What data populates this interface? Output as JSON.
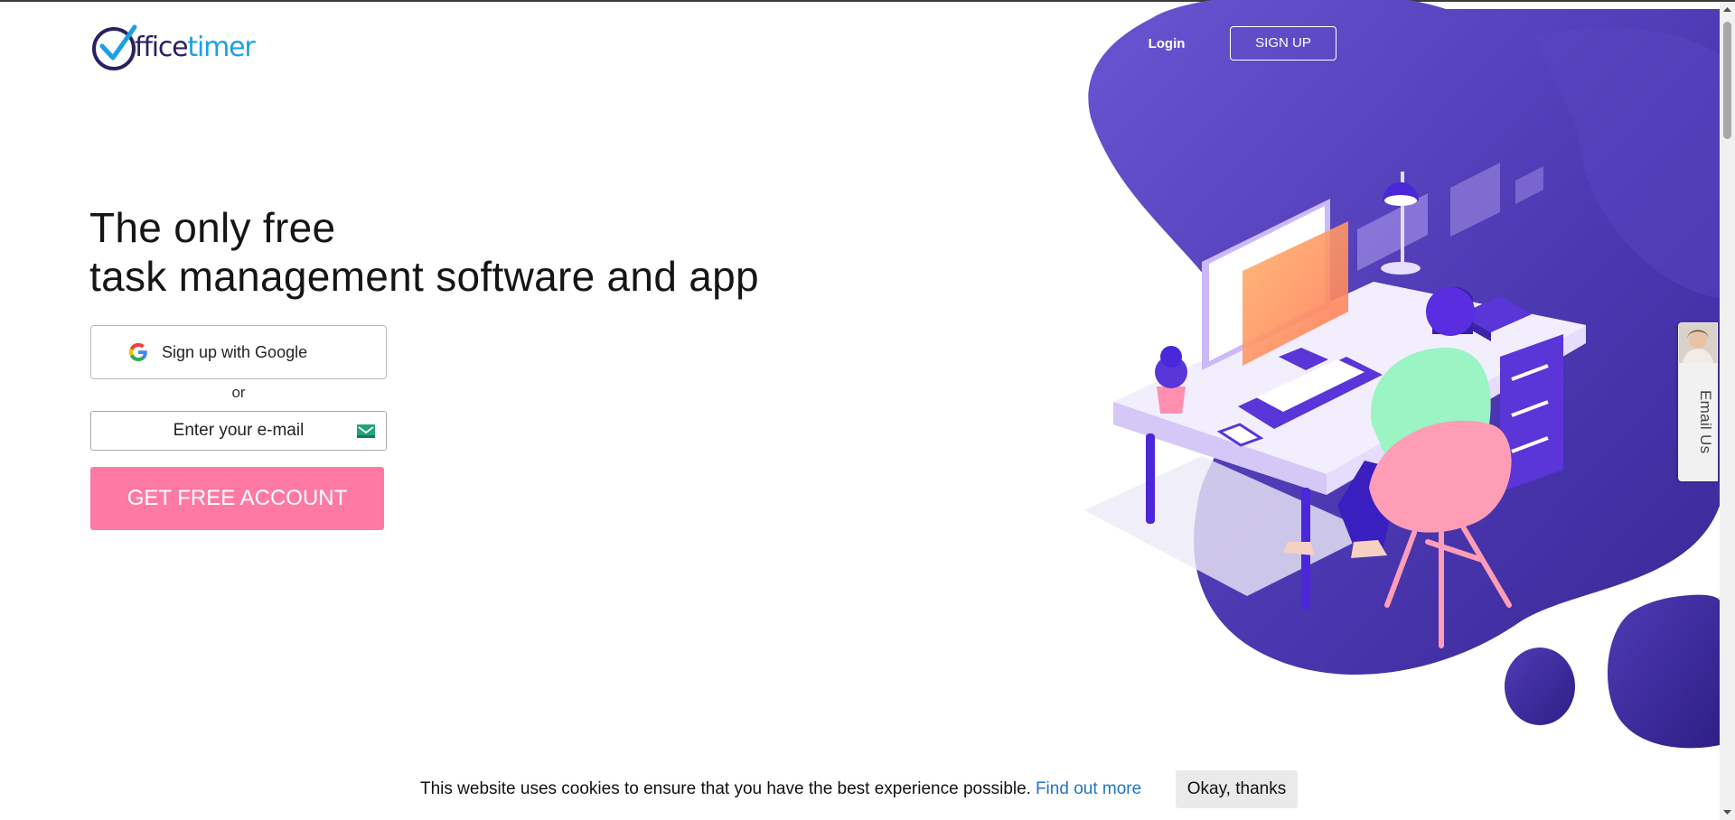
{
  "brand": {
    "logo_part_dark": "ffice",
    "logo_part_light": "timer",
    "colors": {
      "navy": "#2a2160",
      "blue": "#1ba1e2",
      "purple": "#5a3fc6",
      "pink": "#ff7aa3"
    }
  },
  "nav": {
    "login_label": "Login",
    "signup_label": "SIGN UP"
  },
  "hero": {
    "headline_line1": "The only free",
    "headline_line2": "task management software and app"
  },
  "signup": {
    "google_label": "Sign up with Google",
    "or_text": "or",
    "email_placeholder": "Enter your e-mail",
    "cta_label": "GET FREE ACCOUNT"
  },
  "email_tab": {
    "label": "Email Us"
  },
  "cookie": {
    "text": "This website uses cookies to ensure that you have the best experience possible.",
    "link_text": "Find out more",
    "button_label": "Okay, thanks"
  },
  "icons": [
    "officetimer-logo-icon",
    "google-icon",
    "mail-icon",
    "support-avatar-icon",
    "scroll-up-icon",
    "scroll-down-icon"
  ]
}
